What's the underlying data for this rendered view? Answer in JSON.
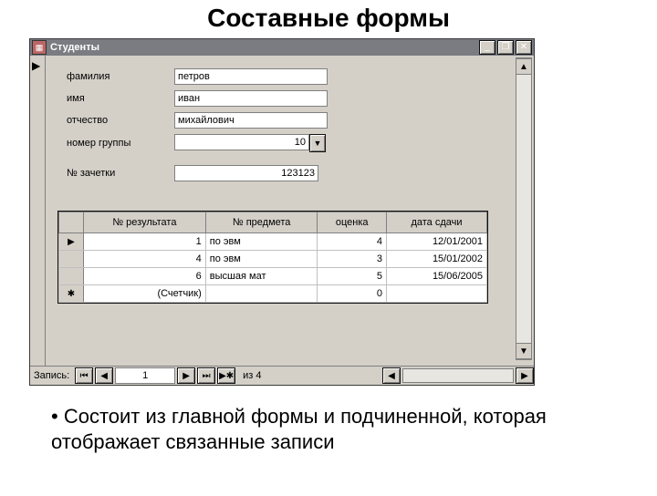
{
  "slide": {
    "title": "Составные формы"
  },
  "window": {
    "title": "Студенты",
    "buttons": {
      "minimize": "_",
      "restore": "❐",
      "close": "✕"
    }
  },
  "main": {
    "marker": "▶",
    "labels": {
      "surname": "фамилия",
      "name": "имя",
      "patronymic": "отчество",
      "group": "номер группы",
      "bookno": "№ зачетки"
    },
    "values": {
      "surname": "петров",
      "name": "иван",
      "patronymic": "михайлович",
      "group": "10",
      "bookno": "123123"
    },
    "combo_dropdown": "▼"
  },
  "sub": {
    "headers": {
      "c0": "",
      "c1": "№ результата",
      "c2": "№ предмета",
      "c3": "оценка",
      "c4": "дата сдачи"
    },
    "rows": [
      {
        "sel": "▶",
        "num": "1",
        "subj": "по эвм",
        "grade": "4",
        "date": "12/01/2001"
      },
      {
        "sel": "",
        "num": "4",
        "subj": "по эвм",
        "grade": "3",
        "date": "15/01/2002"
      },
      {
        "sel": "",
        "num": "6",
        "subj": "высшая мат",
        "grade": "5",
        "date": "15/06/2005"
      },
      {
        "sel": "✱",
        "num": "(Счетчик)",
        "subj": "",
        "grade": "0",
        "date": ""
      }
    ]
  },
  "nav": {
    "label": "Запись:",
    "first": "⏮",
    "prev": "◀",
    "current": "1",
    "next": "▶",
    "last": "⏭",
    "new": "▶✱",
    "of": "из 4"
  },
  "scroll": {
    "left": "◀",
    "right": "▶",
    "up": "▲",
    "down": "▼"
  },
  "bullet": "Состоит из главной формы и подчиненной, которая отображает связанные записи"
}
